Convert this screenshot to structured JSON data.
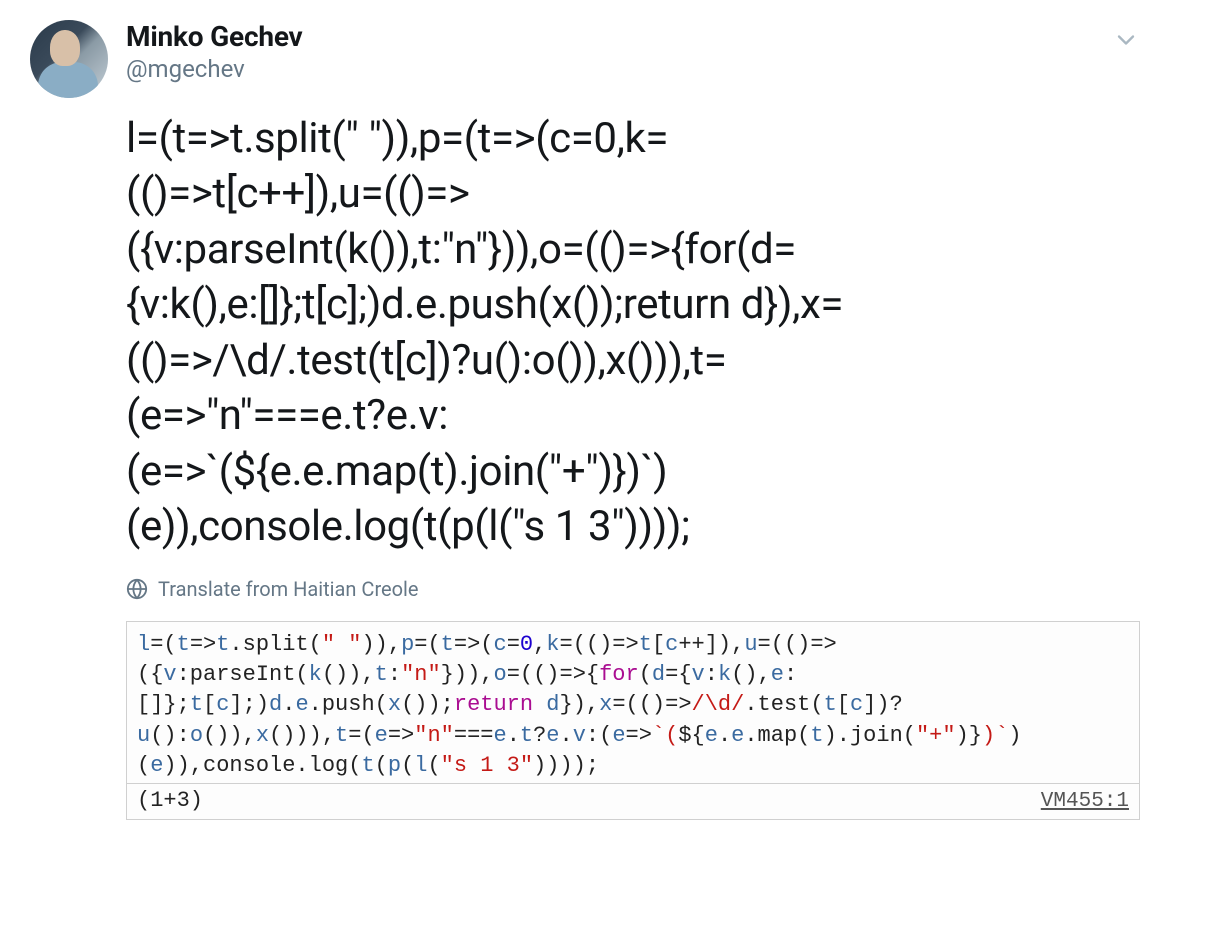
{
  "tweet": {
    "author": {
      "display_name": "Minko Gechev",
      "handle": "@mgechev"
    },
    "text_lines": [
      "l=(t=>t.split(\" \")),p=(t=>(c=0,k=",
      "(()=>t[c++]),u=(()=>",
      "({v:parseInt(k()),t:\"n\"})),o=(()=>{for(d=",
      "{v:k(),e:[]};t[c];)d.e.push(x());return d}),x=",
      "(()=>/\\d/.test(t[c])?u():o()),x())),t=",
      "(e=>\"n\"===e.t?e.v:",
      "(e=>`(${e.e.map(t).join(\"+\")})`)",
      "(e)),console.log(t(p(l(\"s 1 3\"))));"
    ],
    "translate_label": "Translate from Haitian Creole",
    "code_card": {
      "code_lines": [
        "l=(t=>t.split(\" \")),p=(t=>(c=0,k=(()=>t[c++]),u=(()=>",
        "({v:parseInt(k()),t:\"n\"})),o=(()=>{for(d={v:k(),e:",
        "[]};t[c];)d.e.push(x());return d}),x=(()=>/\\d/.test(t[c])?",
        "u():o()),x())),t=(e=>\"n\"===e.t?e.v:(e=>`(${e.e.map(t).join(\"+\")})`)",
        "(e)),console.log(t(p(l(\"s 1 3\"))));"
      ],
      "output": "(1+3)",
      "vm_ref": "VM455:1"
    }
  }
}
